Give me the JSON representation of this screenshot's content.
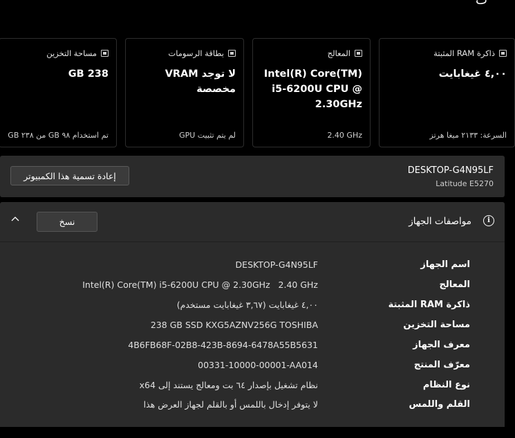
{
  "top_glyph": "ت",
  "cards": [
    {
      "id": "ram",
      "label": "ذاكرة RAM المثبتة",
      "value": "٤,٠٠ غيغابايت",
      "foot": "السرعة: ٢١٣٣ ميغا هرتز"
    },
    {
      "id": "cpu",
      "label": "المعالج",
      "value": "Intel(R) Core(TM) i5-6200U CPU @ 2.30GHz",
      "foot": "2.40 GHz"
    },
    {
      "id": "gpu",
      "label": "بطاقة الرسومات",
      "value": "لا توجد VRAM مخصصة",
      "foot": "لم يتم تثبيت GPU"
    },
    {
      "id": "storage",
      "label": "مساحة التخزين",
      "value": "238 GB",
      "foot": "تم استخدام ٩٨ GB من ٢٣٨ GB"
    }
  ],
  "device": {
    "name": "DESKTOP-G4N95LF",
    "model": "Latitude E5270",
    "rename_label": "إعادة تسمية هذا الكمبيوتر"
  },
  "specs": {
    "title": "مواصفات الجهاز",
    "copy_label": "نسخ",
    "rows": [
      {
        "label": "اسم الجهاز",
        "value": "DESKTOP-G4N95LF"
      },
      {
        "label": "المعالج",
        "value": "Intel(R) Core(TM) i5-6200U CPU @ 2.30GHz   2.40 GHz"
      },
      {
        "label": "ذاكرة RAM المثبتة",
        "value": "٤,٠٠ غيغابايت (٣,٦٧ غيغابايت مستخدم)"
      },
      {
        "label": "مساحة التخزين",
        "value": "238 GB SSD KXG5AZNV256G TOSHIBA"
      },
      {
        "label": "معرف الجهاز",
        "value": "4B6FB68F-02B8-423B-8694-6478A55B5631"
      },
      {
        "label": "معرّف المنتج",
        "value": "00331-10000-00001-AA014"
      },
      {
        "label": "نوع النظام",
        "value": "نظام تشغيل بإصدار ٦٤ بت ومعالج يستند إلى x64"
      },
      {
        "label": "القلم واللمس",
        "value": "لا يتوفر إدخال باللمس أو بالقلم لجهاز العرض هذا"
      }
    ]
  }
}
